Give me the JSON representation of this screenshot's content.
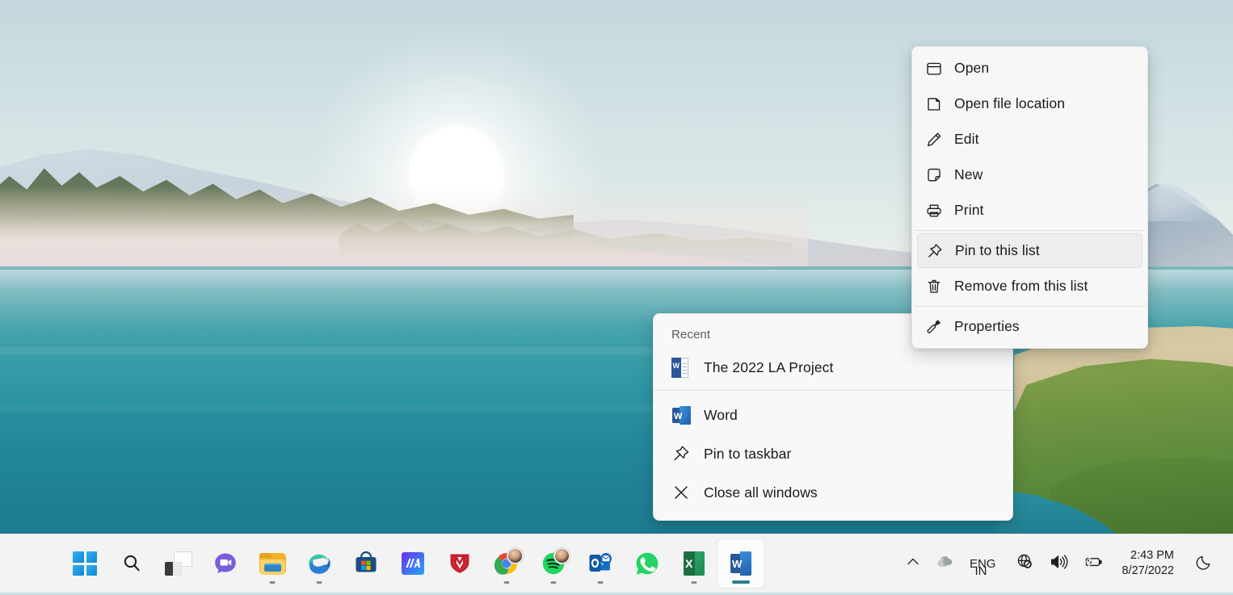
{
  "desktop": {
    "wallpaper_name": "windows-11-lake-sunrise",
    "colors": {
      "sky": "#cfe0e3",
      "lake": "#2e96a3",
      "grass": "#6f9442",
      "sand": "#e3d6d6",
      "taskbar": "#f3f3f3",
      "menu_bg": "#f7f7f7",
      "menu_text": "#1a1a1a",
      "selection": "#ededed",
      "accent": "#0e86d4",
      "active_indicator": "#2d7d8f"
    }
  },
  "context_menu": {
    "name": "taskbar-jumplist-context-menu",
    "items": [
      {
        "label": "Open",
        "icon": "window-icon",
        "selected": false,
        "separator_after": false
      },
      {
        "label": "Open file location",
        "icon": "folder-page-icon",
        "selected": false,
        "separator_after": false
      },
      {
        "label": "Edit",
        "icon": "pencil-icon",
        "selected": false,
        "separator_after": false
      },
      {
        "label": "New",
        "icon": "new-page-icon",
        "selected": false,
        "separator_after": false
      },
      {
        "label": "Print",
        "icon": "printer-icon",
        "selected": false,
        "separator_after": true
      },
      {
        "label": "Pin to this list",
        "icon": "pin-icon",
        "selected": true,
        "separator_after": false
      },
      {
        "label": "Remove from this list",
        "icon": "trash-icon",
        "selected": false,
        "separator_after": true
      },
      {
        "label": "Properties",
        "icon": "wrench-icon",
        "selected": false,
        "separator_after": false
      }
    ]
  },
  "jump_list": {
    "name": "word-jump-list",
    "header": "Recent",
    "recent_items": [
      {
        "label": "The 2022 LA Project",
        "icon": "word-document-icon"
      }
    ],
    "actions": [
      {
        "label": "Word",
        "icon": "word-app-icon"
      },
      {
        "label": "Pin to taskbar",
        "icon": "pin-icon"
      },
      {
        "label": "Close all windows",
        "icon": "close-x-icon"
      }
    ]
  },
  "taskbar": {
    "items": [
      {
        "label": "Start",
        "icon": "windows-start-icon",
        "running": false,
        "active": false,
        "badge": null
      },
      {
        "label": "Search",
        "icon": "search-icon",
        "running": false,
        "active": false,
        "badge": null
      },
      {
        "label": "Task View",
        "icon": "task-view-icon",
        "running": false,
        "active": false,
        "badge": null
      },
      {
        "label": "Chat",
        "icon": "chat-video-icon",
        "running": false,
        "active": false,
        "badge": null
      },
      {
        "label": "File Explorer",
        "icon": "file-explorer-icon",
        "running": true,
        "active": false,
        "badge": null
      },
      {
        "label": "Microsoft Edge",
        "icon": "edge-icon",
        "running": true,
        "active": false,
        "badge": null
      },
      {
        "label": "Microsoft Store",
        "icon": "microsoft-store-icon",
        "running": false,
        "active": false,
        "badge": null
      },
      {
        "label": "MA",
        "icon": "ma-app-icon",
        "running": false,
        "active": false,
        "badge": null
      },
      {
        "label": "McAfee",
        "icon": "mcafee-shield-icon",
        "running": false,
        "active": false,
        "badge": null
      },
      {
        "label": "Google Chrome",
        "icon": "chrome-icon",
        "running": true,
        "active": false,
        "badge": "avatar"
      },
      {
        "label": "Spotify",
        "icon": "spotify-icon",
        "running": true,
        "active": false,
        "badge": "avatar"
      },
      {
        "label": "Outlook",
        "icon": "outlook-icon",
        "running": true,
        "active": false,
        "badge": null
      },
      {
        "label": "WhatsApp",
        "icon": "whatsapp-icon",
        "running": false,
        "active": false,
        "badge": null
      },
      {
        "label": "Excel",
        "icon": "excel-icon",
        "running": true,
        "active": false,
        "badge": null
      },
      {
        "label": "Word",
        "icon": "word-icon",
        "running": true,
        "active": true,
        "badge": null
      }
    ]
  },
  "tray": {
    "show_hidden_icons": {
      "label": "Show hidden icons",
      "icon": "chevron-up-icon"
    },
    "onedrive": {
      "label": "OneDrive",
      "icon": "cloud-icon"
    },
    "language": {
      "line1": "ENG",
      "line2": "IN",
      "icon": "language-indicator"
    },
    "network": {
      "label": "Network - no internet",
      "icon": "globe-no-internet-icon"
    },
    "volume": {
      "label": "Volume",
      "icon": "speaker-icon"
    },
    "battery": {
      "label": "Battery charging",
      "icon": "battery-charging-icon"
    },
    "clock": {
      "time": "2:43 PM",
      "date": "8/27/2022"
    },
    "notifications": {
      "label": "Do not disturb",
      "icon": "moon-icon"
    }
  }
}
